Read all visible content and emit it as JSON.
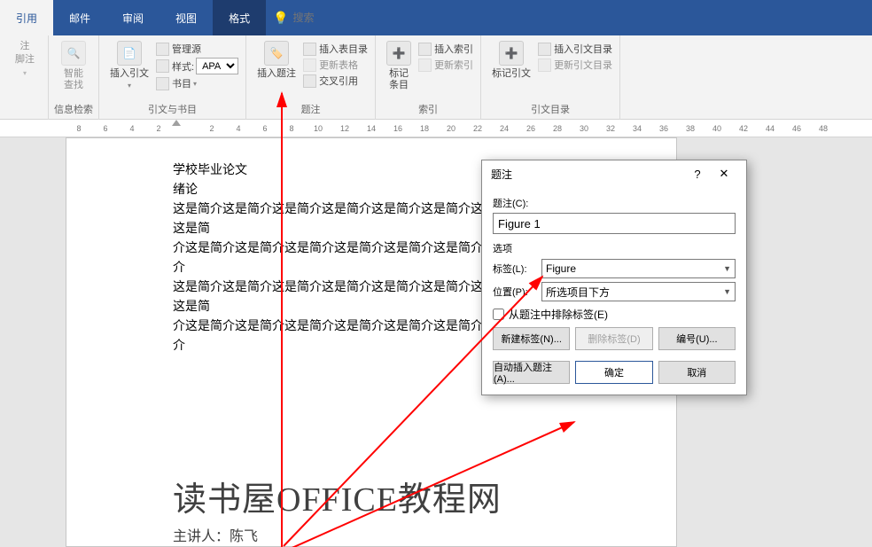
{
  "tabs": {
    "references": "引用",
    "mail": "邮件",
    "review": "审阅",
    "view": "视图",
    "format": "格式",
    "search_placeholder": "搜索"
  },
  "ribbon": {
    "g1_lbl": "注",
    "g1_foot": "脚注",
    "g2_btn": "智能\n查找",
    "g2_lbl": "信息检索",
    "g3_btn": "插入引文",
    "g3_mgr": "管理源",
    "g3_style": "样式:",
    "g3_style_val": "APA",
    "g3_bib": "书目",
    "g3_lbl": "引文与书目",
    "g4_btn": "插入题注",
    "g4_toc": "插入表目录",
    "g4_upd": "更新表格",
    "g4_cross": "交叉引用",
    "g4_lbl": "题注",
    "g5_btn": "标记\n条目",
    "g5_idx": "插入索引",
    "g5_upd": "更新索引",
    "g5_lbl": "索引",
    "g6_btn": "标记引文",
    "g6_idx": "插入引文目录",
    "g6_upd": "更新引文目录",
    "g6_lbl": "引文目录"
  },
  "ruler": [
    "8",
    "6",
    "4",
    "2",
    "",
    "2",
    "4",
    "6",
    "8",
    "10",
    "12",
    "14",
    "16",
    "18",
    "20",
    "22",
    "24",
    "26",
    "28",
    "30",
    "32",
    "34",
    "36",
    "38",
    "40",
    "42",
    "44",
    "46",
    "48"
  ],
  "doc": {
    "l1": "学校毕业论文",
    "l2": "绪论",
    "l3": "这是简介这是简介这是简介这是简介这是简介这是简介这是简介这是简介这是简",
    "l4": "介这是简介这是简介这是简介这是简介这是简介这是简介这是简介这是简介",
    "l5": "这是简介这是简介这是简介这是简介这是简介这是简介这是简介这是简介这是简",
    "l6": "介这是简介这是简介这是简介这是简介这是简介这是简介这是简介这是简介",
    "title": "读书屋OFFICE教程网",
    "sub": "主讲人：陈飞"
  },
  "dialog": {
    "title": "题注",
    "help": "?",
    "close": "✕",
    "cap_label": "题注(C):",
    "cap_value": "Figure 1",
    "options": "选项",
    "label_l": "标签(L):",
    "label_val": "Figure",
    "pos_l": "位置(P):",
    "pos_val": "所选项目下方",
    "exclude": "从题注中排除标签(E)",
    "new_label": "新建标签(N)...",
    "del_label": "删除标签(D)",
    "number": "编号(U)...",
    "auto": "自动插入题注(A)...",
    "ok": "确定",
    "cancel": "取消"
  }
}
